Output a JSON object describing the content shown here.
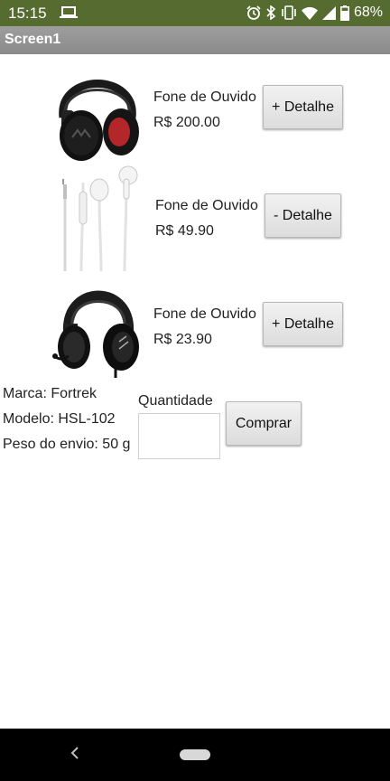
{
  "status_bar": {
    "time": "15:15",
    "battery": "68%",
    "icons": [
      "laptop-icon",
      "alarm-icon",
      "bluetooth-icon",
      "vibrate-icon",
      "wifi-icon",
      "signal-icon",
      "battery-icon"
    ]
  },
  "app": {
    "title": "Screen1"
  },
  "products": [
    {
      "name": "Fone de Ouvido",
      "price": "R$ 200.00",
      "button": "+ Detalhe"
    },
    {
      "name": "Fone de Ouvido",
      "price": "R$ 49.90",
      "button": "- Detalhe"
    },
    {
      "name": "Fone de Ouvido",
      "price": "R$ 23.90",
      "button": "+ Detalhe"
    }
  ],
  "details": {
    "brand": "Marca: Fortrek",
    "model": "Modelo: HSL-102",
    "weight": "Peso do envio: 50 g"
  },
  "purchase": {
    "quantity_label": "Quantidade",
    "quantity_value": "",
    "buy_button": "Comprar"
  },
  "colors": {
    "status_bar": "#556b2f",
    "title_bar": "#939393",
    "nav_bar": "#000000"
  }
}
